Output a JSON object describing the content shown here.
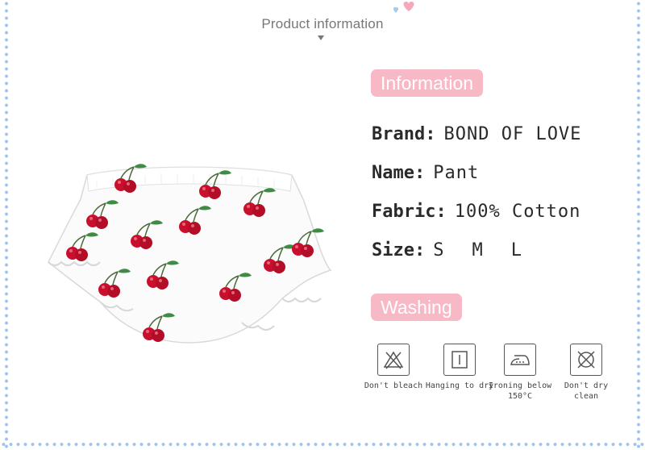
{
  "header": {
    "title": "Product information"
  },
  "sections": {
    "information_label": "Information",
    "washing_label": "Washing"
  },
  "details": {
    "brand_key": "Brand:",
    "brand_value": "BOND OF LOVE",
    "name_key": "Name:",
    "name_value": "Pant",
    "fabric_key": "Fabric:",
    "fabric_value": "100% Cotton",
    "size_key": "Size:",
    "sizes": [
      "S",
      "M",
      "L"
    ]
  },
  "care": [
    {
      "icon": "no-bleach-icon",
      "label": "Don't bleach"
    },
    {
      "icon": "hang-dry-icon",
      "label": "Hanging to dry"
    },
    {
      "icon": "iron-icon",
      "label": "Ironing below 150°C"
    },
    {
      "icon": "no-dry-clean-icon",
      "label": "Don't dry clean"
    }
  ],
  "colors": {
    "pill_bg": "#f7b9c6",
    "border_hearts": "#9ec6ea",
    "cherry": "#c8102e",
    "leaf": "#2f7d3a"
  }
}
